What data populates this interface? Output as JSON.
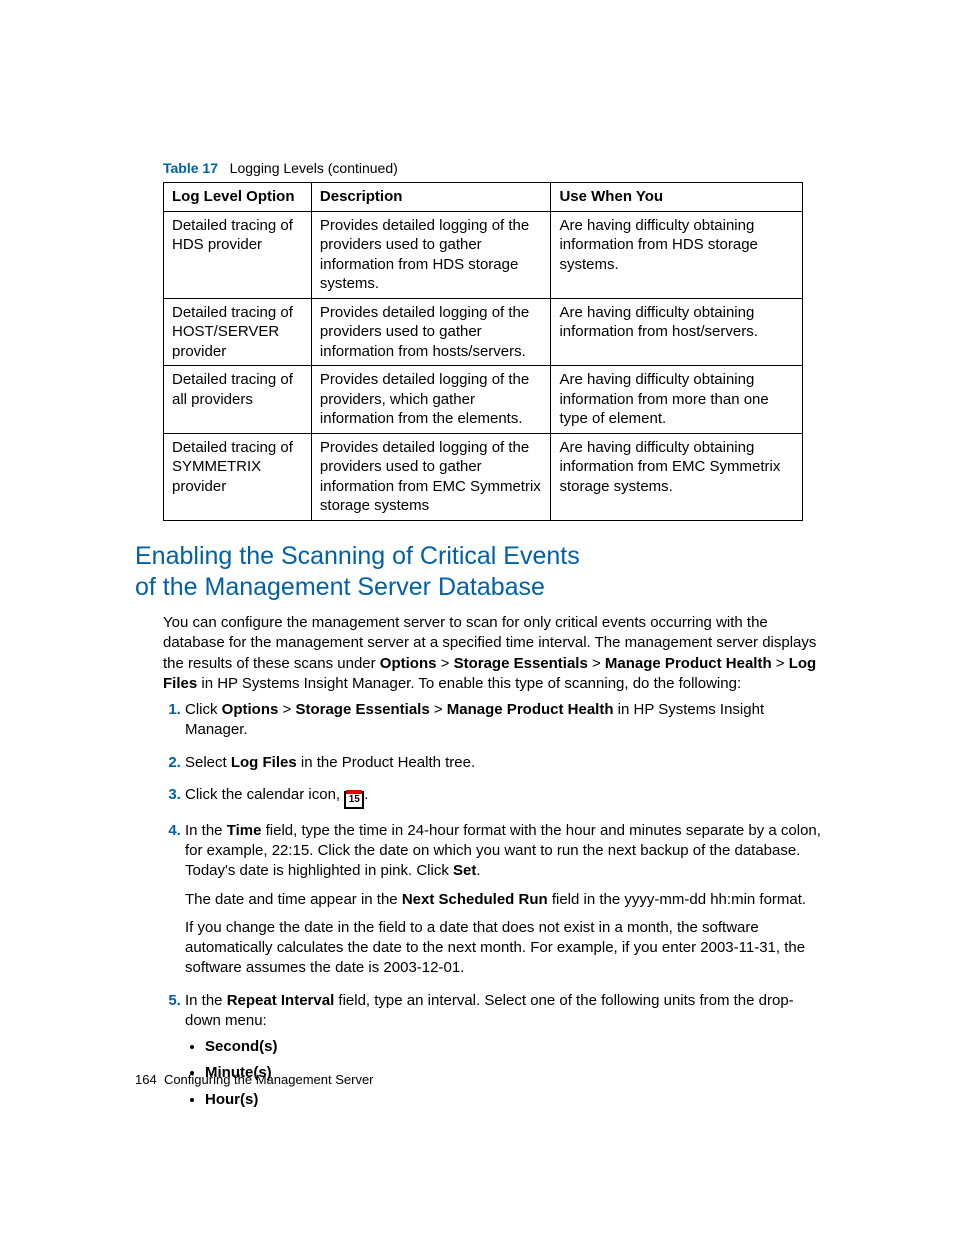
{
  "tableCaption": {
    "label": "Table 17",
    "title": "Logging Levels (continued)"
  },
  "table": {
    "headers": [
      "Log Level Option",
      "Description",
      "Use When You"
    ],
    "rows": [
      {
        "c1": "Detailed tracing of HDS provider",
        "c2": "Provides detailed logging of the providers used to gather information from HDS storage systems.",
        "c3": "Are having difficulty obtaining information from HDS storage systems."
      },
      {
        "c1": "Detailed tracing of HOST/SERVER provider",
        "c2": "Provides detailed logging of the providers used to gather information from hosts/servers.",
        "c3": "Are having difficulty obtaining information from host/servers."
      },
      {
        "c1": "Detailed tracing of all providers",
        "c2": "Provides detailed logging of the providers, which gather information from the elements.",
        "c3": "Are having difficulty obtaining information from more than one type of element."
      },
      {
        "c1": "Detailed tracing of SYMMETRIX provider",
        "c2": "Provides detailed logging of the providers used to gather information from EMC Symmetrix storage systems",
        "c3": "Are having difficulty obtaining information from EMC Symmetrix storage systems."
      }
    ]
  },
  "heading": {
    "line1": "Enabling the Scanning of Critical Events",
    "line2": "of the Management Server Database"
  },
  "intro": {
    "p1a": "You can configure the management server to scan for only critical events occurring with the database for the management server at a specified time interval. The management server displays the results of these scans under ",
    "opt": "Options",
    "gt1": " > ",
    "se": "Storage Essentials",
    "gt2": " > ",
    "mph": "Manage Product Health",
    "gt3": " > ",
    "lf": "Log Files",
    "p1b": " in HP Systems Insight Manager. To enable this type of scanning, do the following:"
  },
  "steps": {
    "s1": {
      "a": "Click ",
      "b1": "Options",
      "m1": " > ",
      "b2": "Storage Essentials",
      "m2": " > ",
      "b3": "Manage Product Health",
      "c": " in HP Systems Insight Manager."
    },
    "s2": {
      "a": "Select ",
      "b1": "Log Files",
      "c": " in the Product Health tree."
    },
    "s3": {
      "a": "Click the calendar icon, ",
      "iconText": "15",
      "c": "."
    },
    "s4": {
      "a": "In the ",
      "b1": "Time",
      "b": " field, type the time in 24-hour format with the hour and minutes separate by a colon, for example, 22:15. Click the date on which you want to run the next backup of the database. Today's date is highlighted in pink. Click ",
      "b2": "Set",
      "c": ".",
      "p2a": "The date and time appear in the ",
      "b3": "Next Scheduled Run",
      "p2b": " field in the yyyy-mm-dd hh:min format.",
      "p3": "If you change the date in the field to a date that does not exist in a month, the software automatically calculates the date to the next month. For example, if you enter 2003-11-31, the software assumes the date is 2003-12-01."
    },
    "s5": {
      "a": "In the ",
      "b1": "Repeat Interval",
      "b": " field, type an interval. Select one of the following units from the drop-down menu:",
      "u1": "Second(s)",
      "u2": "Minute(s)",
      "u3": "Hour(s)"
    }
  },
  "footer": {
    "page": "164",
    "title": "Configuring the Management Server"
  }
}
